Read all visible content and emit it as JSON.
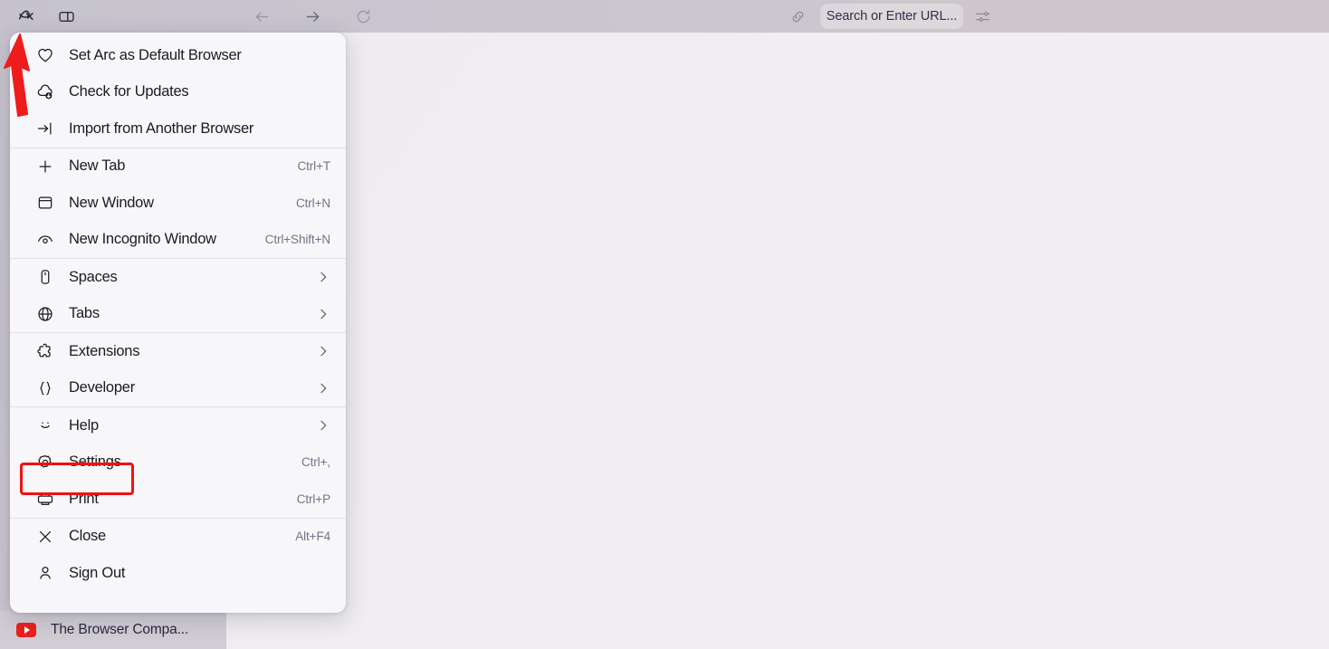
{
  "app": {
    "name": "Arc Browser"
  },
  "toolbar": {
    "arc_logo": "arc-logo-icon",
    "sidebar_toggle": "sidebar-toggle-icon",
    "back": "back-arrow-icon",
    "forward": "forward-arrow-icon",
    "reload": "reload-icon",
    "link": "link-icon",
    "tune": "tune-sliders-icon",
    "url_placeholder": "Search or Enter URL..."
  },
  "sidebar": {
    "tabs": [
      {
        "title": "The Browser Compa...",
        "favicon": "youtube-favicon"
      }
    ]
  },
  "menu": {
    "groups": [
      {
        "items": [
          {
            "label": "Set Arc as Default Browser",
            "icon": "heart-icon",
            "shortcut": "",
            "submenu": false
          },
          {
            "label": "Check for Updates",
            "icon": "cloud-download-icon",
            "shortcut": "",
            "submenu": false
          },
          {
            "label": "Import from Another Browser",
            "icon": "import-arrow-icon",
            "shortcut": "",
            "submenu": false
          }
        ]
      },
      {
        "items": [
          {
            "label": "New Tab",
            "icon": "plus-icon",
            "shortcut": "Ctrl+T",
            "submenu": false
          },
          {
            "label": "New Window",
            "icon": "window-icon",
            "shortcut": "Ctrl+N",
            "submenu": false
          },
          {
            "label": "New Incognito Window",
            "icon": "incognito-icon",
            "shortcut": "Ctrl+Shift+N",
            "submenu": false
          }
        ]
      },
      {
        "items": [
          {
            "label": "Spaces",
            "icon": "spaces-icon",
            "shortcut": "",
            "submenu": true
          },
          {
            "label": "Tabs",
            "icon": "globe-icon",
            "shortcut": "",
            "submenu": true
          }
        ]
      },
      {
        "items": [
          {
            "label": "Extensions",
            "icon": "extensions-puzzle-icon",
            "shortcut": "",
            "submenu": true
          },
          {
            "label": "Developer",
            "icon": "curly-braces-icon",
            "shortcut": "",
            "submenu": true
          }
        ]
      },
      {
        "items": [
          {
            "label": "Help",
            "icon": "smiley-icon",
            "shortcut": "",
            "submenu": true
          },
          {
            "label": "Settings",
            "icon": "gear-icon",
            "shortcut": "Ctrl+,",
            "submenu": false,
            "highlighted": true
          },
          {
            "label": "Print",
            "icon": "printer-icon",
            "shortcut": "Ctrl+P",
            "submenu": false
          }
        ]
      },
      {
        "items": [
          {
            "label": "Close",
            "icon": "close-x-icon",
            "shortcut": "Alt+F4",
            "submenu": false
          },
          {
            "label": "Sign Out",
            "icon": "person-icon",
            "shortcut": "",
            "submenu": false
          }
        ]
      }
    ]
  },
  "annotations": {
    "highlight_color": "#ef1111",
    "arrow_color": "#ee1c1c",
    "highlight_target": "Settings",
    "arrow_target": "arc-logo-icon"
  },
  "colors": {
    "toolbar_bg": "#cac6d0",
    "content_bg": "#efedf0",
    "menu_bg": "#f7f6f9",
    "menu_text": "#1c1b22",
    "shortcut_text": "#757383",
    "accent_red": "#ef1111",
    "youtube_red": "#eb2020"
  }
}
